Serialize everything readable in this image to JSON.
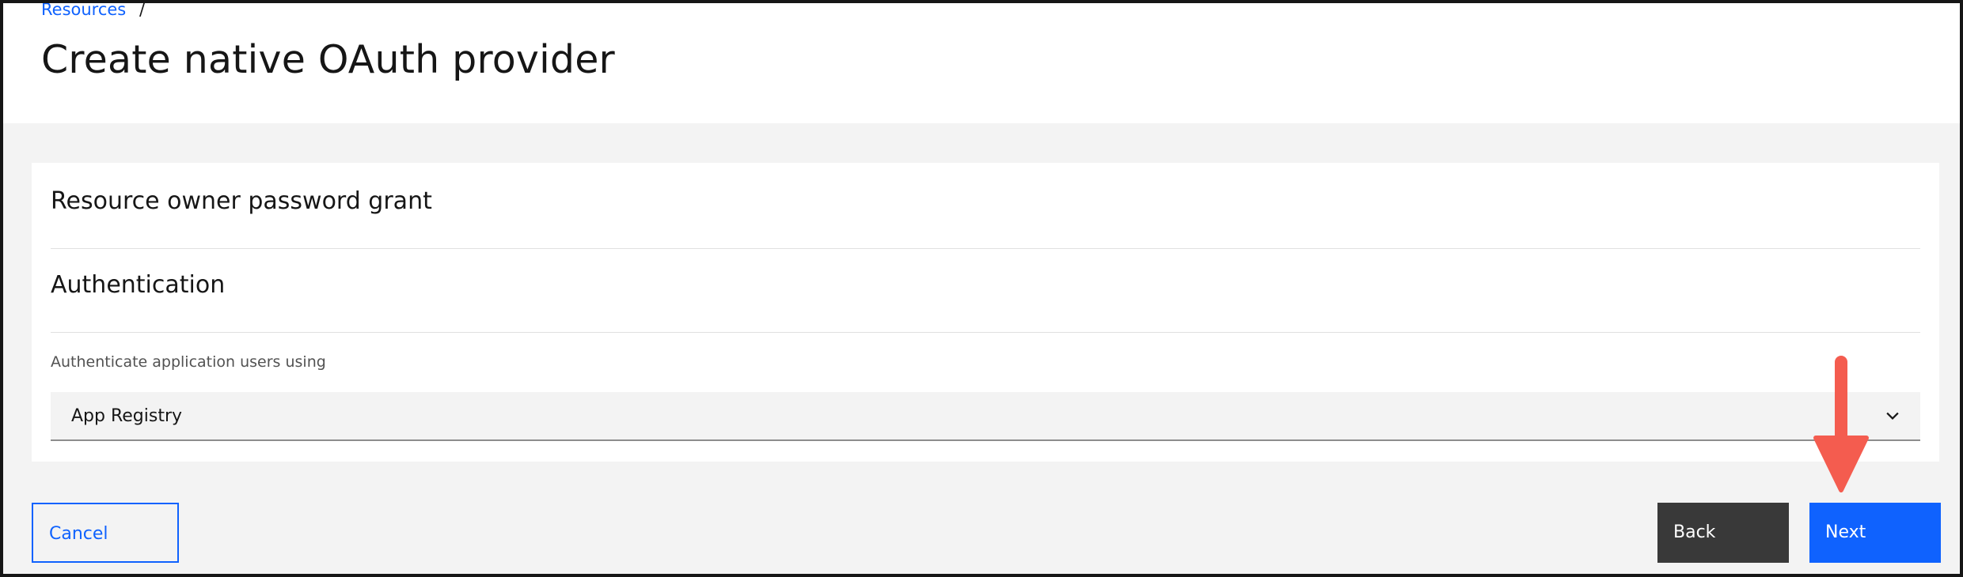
{
  "breadcrumb": {
    "items": [
      "Resources"
    ],
    "separator": "/"
  },
  "page": {
    "title": "Create native OAuth provider"
  },
  "sections": {
    "grant_heading": "Resource owner password grant",
    "auth_heading": "Authentication"
  },
  "auth_select": {
    "label": "Authenticate application users using",
    "value": "App Registry"
  },
  "footer": {
    "cancel_label": "Cancel",
    "back_label": "Back",
    "next_label": "Next"
  },
  "colors": {
    "primary": "#0f62fe",
    "secondary_button": "#393939",
    "annotation_arrow": "#f45c4f"
  },
  "annotation": {
    "icon": "red-arrow-down-icon"
  }
}
